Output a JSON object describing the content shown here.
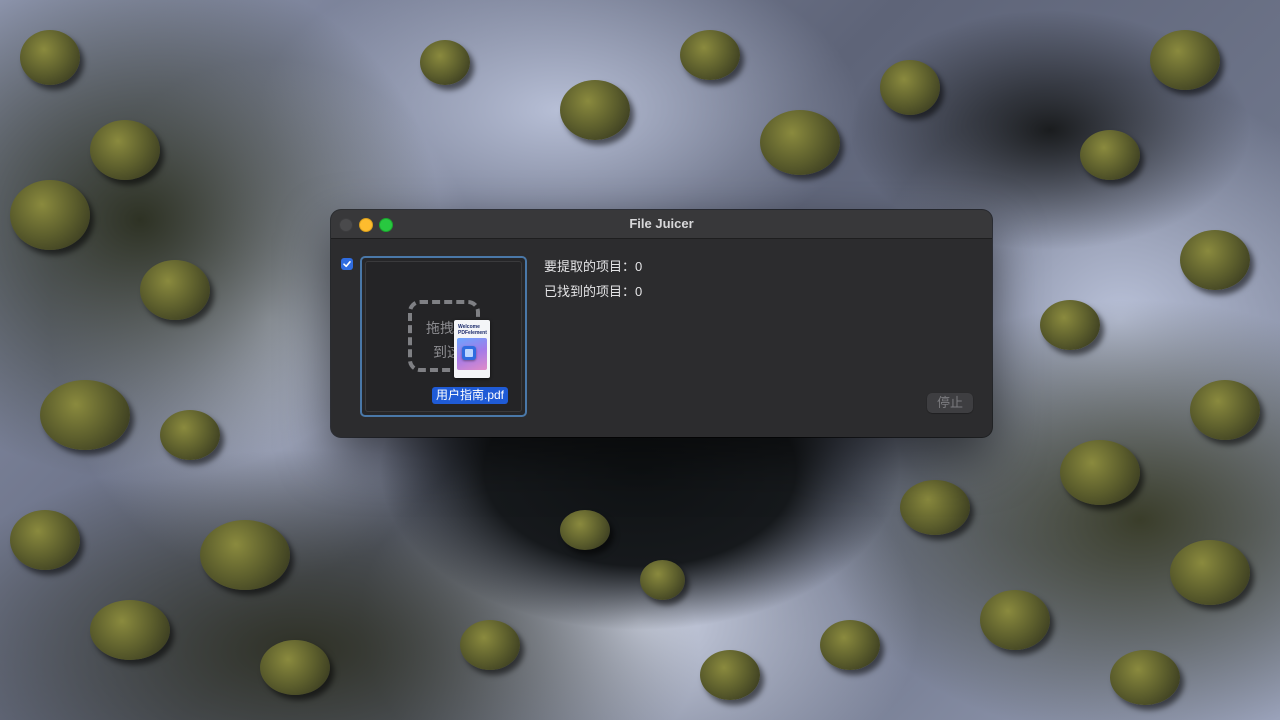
{
  "window": {
    "title": "File Juicer"
  },
  "extract_checkbox": {
    "checked": true
  },
  "drop_area": {
    "prompt_line1": "拖拽文",
    "prompt_line2": "到这",
    "file_thumbnail_text": "Welcome PDFelement",
    "file_name": "用户指南.pdf"
  },
  "status": {
    "items_to_extract": "要提取的项目：0",
    "items_found": "已找到的项目：0"
  },
  "buttons": {
    "stop_label": "停止"
  },
  "colors": {
    "accent": "#1f5bd6",
    "window_bg": "#2c2c2e",
    "minimize": "#febc2e",
    "maximize": "#28c840"
  }
}
